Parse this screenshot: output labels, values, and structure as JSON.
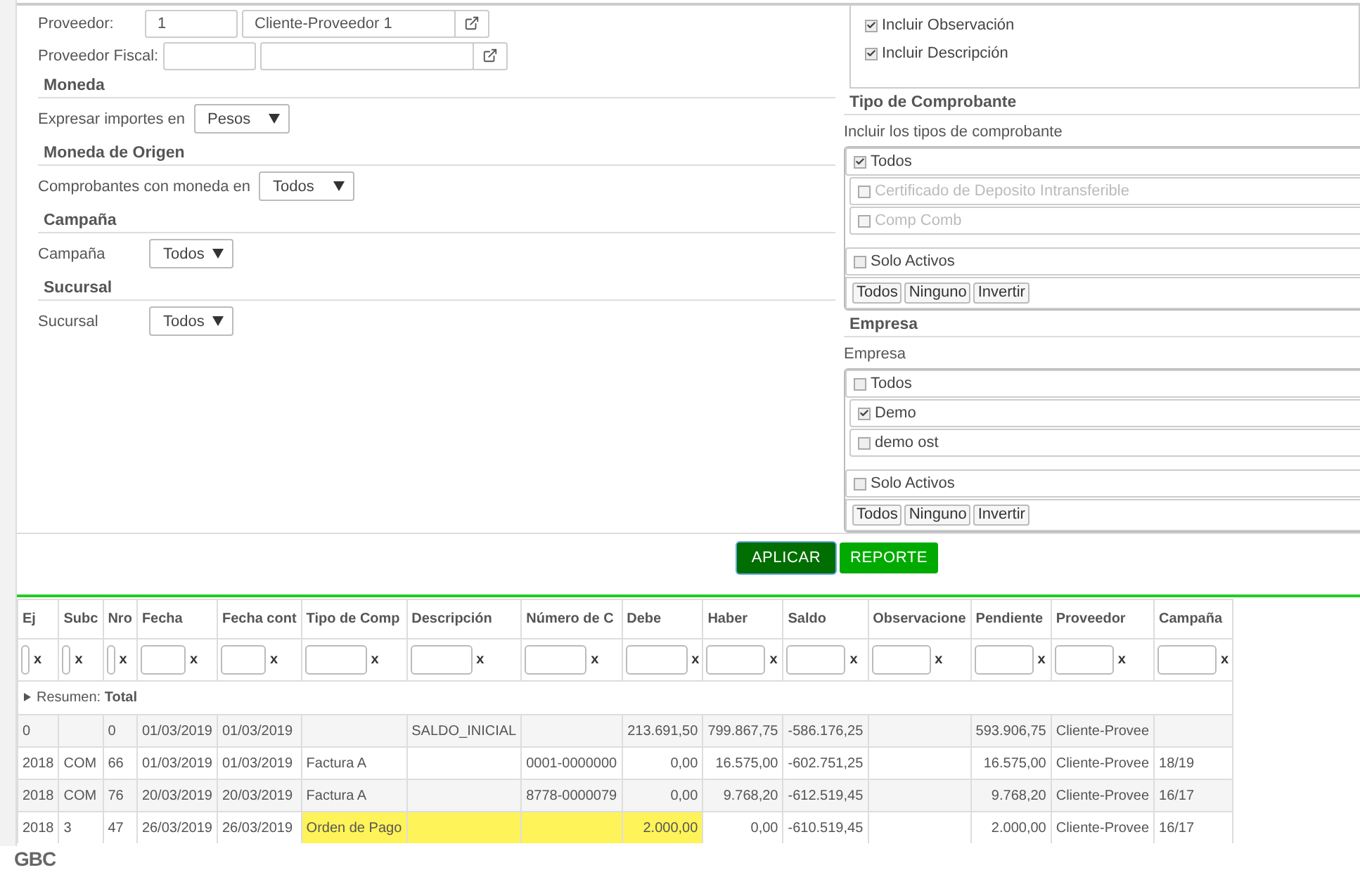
{
  "proveedor": {
    "label": "Proveedor:",
    "code": "1",
    "name": "Cliente-Proveedor 1"
  },
  "proveedor_fiscal": {
    "label": "Proveedor Fiscal:"
  },
  "sections": [
    {
      "title": "Moneda",
      "field": {
        "label": "Expresar importes en",
        "value": "Pesos"
      }
    },
    {
      "title": "Moneda de Origen",
      "field": {
        "label": "Comprobantes con moneda en",
        "value": "Todos"
      }
    },
    {
      "title": "Campaña",
      "field": {
        "label": "Campaña",
        "value": "Todos"
      }
    },
    {
      "title": "Sucursal",
      "field": {
        "label": "Sucursal",
        "value": "Todos"
      }
    }
  ],
  "options": [
    {
      "label": "Incluir Observación",
      "checked": true
    },
    {
      "label": "Incluir Descripción",
      "checked": true
    }
  ],
  "lists": [
    {
      "title": "Tipo de Comprobante",
      "hint": "Incluir los tipos de comprobante",
      "items": [
        {
          "label": "Todos",
          "checked": true,
          "disabled": false
        },
        {
          "label": "Certificado de Deposito Intransferible",
          "checked": false,
          "disabled": true
        },
        {
          "label": "Comp Comb",
          "checked": false,
          "disabled": true
        }
      ],
      "solo_activos": {
        "label": "Solo Activos",
        "checked": false
      },
      "buttons": [
        "Todos",
        "Ninguno",
        "Invertir"
      ]
    },
    {
      "title": "Empresa",
      "hint": "Empresa",
      "items": [
        {
          "label": "Todos",
          "checked": false,
          "disabled": false
        },
        {
          "label": "Demo",
          "checked": true,
          "disabled": false
        },
        {
          "label": "demo ost",
          "checked": false,
          "disabled": false
        }
      ],
      "solo_activos": {
        "label": "Solo Activos",
        "checked": false
      },
      "buttons": [
        "Todos",
        "Ninguno",
        "Invertir"
      ]
    }
  ],
  "actions": [
    {
      "label": "APLICAR",
      "focused": true
    },
    {
      "label": "REPORTE",
      "focused": false
    }
  ],
  "table": {
    "columns": [
      "Ej",
      "Subc",
      "Nro",
      "Fecha",
      "Fecha cont",
      "Tipo de Comp",
      "Descripción",
      "Número de C",
      "Debe",
      "Haber",
      "Saldo",
      "Observacione",
      "Pendiente",
      "Proveedor",
      "Campaña"
    ],
    "filters": [
      {
        "clear": "x"
      },
      {
        "clear": "x"
      },
      {
        "clear": "x"
      },
      {
        "clear": "x"
      },
      {
        "clear": "x"
      },
      {
        "clear": "x"
      },
      {
        "clear": "x"
      },
      {
        "clear": "x"
      },
      {
        "clear": "x"
      },
      {
        "clear": "x"
      },
      {
        "clear": "x"
      },
      {
        "clear": "x"
      },
      {
        "clear": "x"
      },
      {
        "clear": "x"
      },
      {
        "clear": "x"
      }
    ],
    "summary": "Resumen: **Total**",
    "rows": [
      {
        "marked": false,
        "cells": [
          "0",
          "",
          "0",
          "01/03/2019",
          "01/03/2019",
          "",
          "SALDO_INICIAL",
          "",
          "213.691,50",
          "799.867,75",
          "-586.176,25",
          "",
          "593.906,75",
          "Cliente-Provee",
          ""
        ]
      },
      {
        "marked": false,
        "cells": [
          "2018",
          "COM",
          "66",
          "01/03/2019",
          "01/03/2019",
          "Factura A",
          "",
          "0001-0000000",
          "0,00",
          "16.575,00",
          "-602.751,25",
          "",
          "16.575,00",
          "Cliente-Provee",
          "18/19"
        ]
      },
      {
        "marked": false,
        "cells": [
          "2018",
          "COM",
          "76",
          "20/03/2019",
          "20/03/2019",
          "Factura A",
          "",
          "8778-0000079",
          "0,00",
          "9.768,20",
          "-612.519,45",
          "",
          "9.768,20",
          "Cliente-Provee",
          "16/17"
        ]
      },
      {
        "marked": true,
        "cells": [
          "2018",
          "3",
          "47",
          "26/03/2019",
          "26/03/2019",
          "Orden de Pago",
          "",
          "",
          "2.000,00",
          "0,00",
          "-610.519,45",
          "",
          "2.000,00",
          "Cliente-Provee",
          "16/17"
        ]
      }
    ]
  },
  "footer": {
    "logo": "GBC"
  }
}
